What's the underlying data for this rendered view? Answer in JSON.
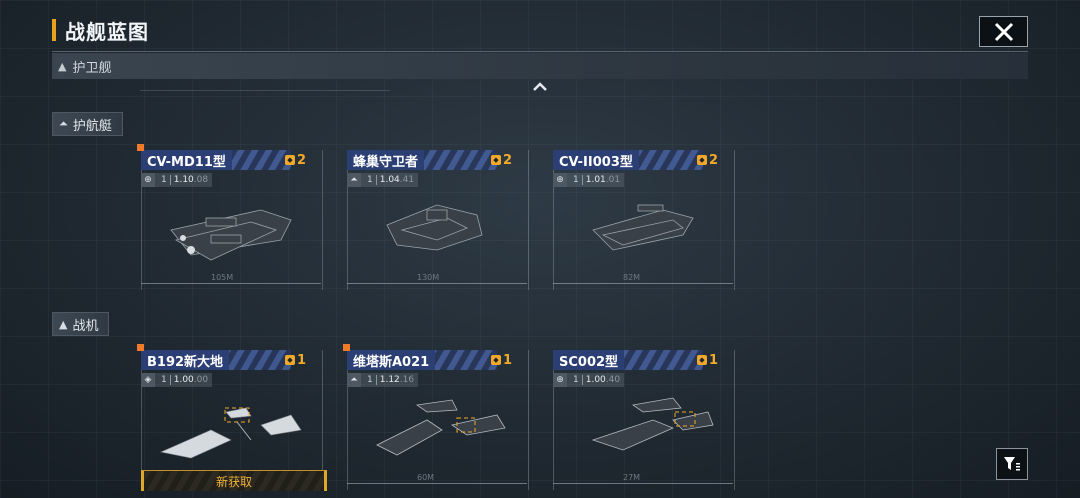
{
  "header": {
    "title": "战舰蓝图",
    "close_icon": "close-icon"
  },
  "category": {
    "label": "护卫舰"
  },
  "sections": [
    {
      "label": "护航艇",
      "icon": "escort-boat-icon"
    },
    {
      "label": "战机",
      "icon": "fighter-icon"
    }
  ],
  "cards": [
    {
      "name": "CV-MD11型",
      "cost": "2",
      "stat_icon": "globe-icon",
      "level": "1",
      "stat_main": "1.10",
      "stat_sub": ".08",
      "length": "105M",
      "new": true,
      "acquire": ""
    },
    {
      "name": "蜂巢守卫者",
      "cost": "2",
      "stat_icon": "ship-icon",
      "level": "1",
      "stat_main": "1.04",
      "stat_sub": ".41",
      "length": "130M",
      "new": false,
      "acquire": ""
    },
    {
      "name": "CV-II003型",
      "cost": "2",
      "stat_icon": "globe-icon",
      "level": "1",
      "stat_main": "1.01",
      "stat_sub": ".01",
      "length": "82M",
      "new": false,
      "acquire": ""
    },
    {
      "name": "B192新大地",
      "cost": "1",
      "stat_icon": "drone-icon",
      "level": "1",
      "stat_main": "1.00",
      "stat_sub": ".00",
      "length": "",
      "new": true,
      "acquire": "新获取"
    },
    {
      "name": "维塔斯A021",
      "cost": "1",
      "stat_icon": "ship-icon",
      "level": "1",
      "stat_main": "1.12",
      "stat_sub": ".16",
      "length": "60M",
      "new": true,
      "acquire": ""
    },
    {
      "name": "SC002型",
      "cost": "1",
      "stat_icon": "globe-icon",
      "level": "1",
      "stat_main": "1.00",
      "stat_sub": ".40",
      "length": "27M",
      "new": false,
      "acquire": ""
    }
  ],
  "filter": {
    "icon": "filter-icon"
  },
  "colors": {
    "accent": "#e8a21c",
    "name_strip": "#2c3f75",
    "cost": "#f2a92a",
    "new_dot": "#f07a2a"
  }
}
